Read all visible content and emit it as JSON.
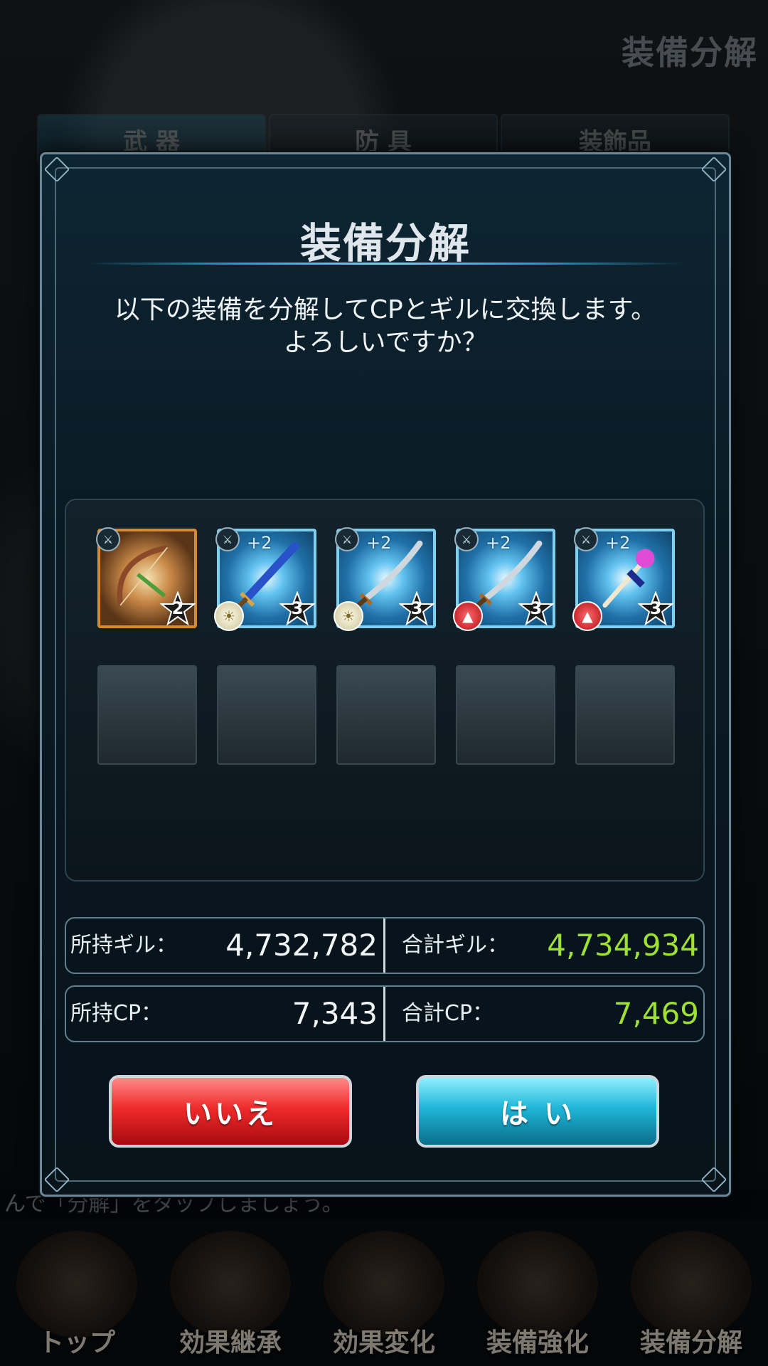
{
  "background": {
    "header_title": "装備分解",
    "tabs": [
      "武 器",
      "防 具",
      "装飾品"
    ],
    "hint_text": "んで「分解」をタップしましょう。",
    "nav": [
      {
        "label": "トップ"
      },
      {
        "label": "効果継承"
      },
      {
        "label": "効果変化"
      },
      {
        "label": "装備強化"
      },
      {
        "label": "装備分解"
      }
    ]
  },
  "modal": {
    "title": "装備分解",
    "message_line1": "以下の装備を分解してCPとギルに交換します。",
    "message_line2": "よろしいですか？",
    "items": [
      {
        "weapon": "bow",
        "rarity": "2",
        "plus": "",
        "frame": "gold",
        "element": ""
      },
      {
        "weapon": "sword",
        "rarity": "3",
        "plus": "+2",
        "frame": "blue",
        "element": "light"
      },
      {
        "weapon": "katana",
        "rarity": "3",
        "plus": "+2",
        "frame": "blue",
        "element": "light"
      },
      {
        "weapon": "katana",
        "rarity": "3",
        "plus": "+2",
        "frame": "blue",
        "element": "fire"
      },
      {
        "weapon": "staff",
        "rarity": "3",
        "plus": "+2",
        "frame": "blue",
        "element": "fire"
      }
    ],
    "empty_slots": 5,
    "stats": {
      "owned_gil_label": "所持ギル：",
      "owned_gil_value": "4,732,782",
      "total_gil_label": "合計ギル：",
      "total_gil_value": "4,734,934",
      "owned_cp_label": "所持CP：",
      "owned_cp_value": "7,343",
      "total_cp_label": "合計CP：",
      "total_cp_value": "7,469"
    },
    "buttons": {
      "no_label": "いいえ",
      "yes_label": "は い"
    }
  },
  "colors": {
    "total_value": "#9ee132",
    "no_button": "#e3202a",
    "yes_button": "#1fb6d8"
  }
}
